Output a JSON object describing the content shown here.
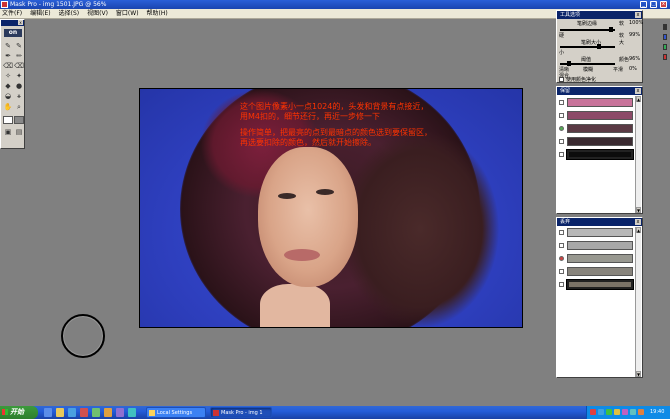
{
  "window": {
    "title": "Mask Pro - img 1501.JPG @ 56%",
    "minimize_label": "_",
    "maximize_label": "□",
    "close_label": "x"
  },
  "menu": {
    "items": [
      "文件(F)",
      "编辑(E)",
      "选择(S)",
      "视图(V)",
      "窗口(W)",
      "帮助(H)"
    ]
  },
  "toolbox": {
    "logo": "on",
    "close_label": "x"
  },
  "canvas": {
    "annotation_lines": [
      "这个图片像素小一点1024的，头发和背景有点接近，",
      "用M4扣的，细节还行，再近一步修一下",
      "操作简单，把最亮的点到最暗点的颜色选到要保留区，",
      "再选要扣除的颜色，然后就开始擦除。"
    ]
  },
  "tool_options": {
    "title": "工具选项",
    "close_label": "x",
    "row1_label": "笔刷边缘",
    "row1_right": "软",
    "row1_value": "100%",
    "row2_left": "硬",
    "row2_right": "软",
    "row2_value": "99%",
    "row3_label": "笔刷大小",
    "row3_right": "大",
    "row4_label": "阈值",
    "row4_left": "小",
    "row5_label": "颜色",
    "row5_value": "96%",
    "row6_left": "清晰",
    "row6_mid": "模糊",
    "row6_right": "平滑",
    "row6_value": "0%",
    "row7_left": "混合",
    "checkbox_label": "使用颜色净化"
  },
  "keep_colors": {
    "title": "保留",
    "close_label": "x",
    "swatches": [
      "#c8739a",
      "#8c4a68",
      "#5a3a44",
      "#3a2a30",
      "#0c0c0c"
    ],
    "selected_index": 4
  },
  "drop_colors": {
    "title": "丢弃",
    "close_label": "x",
    "swatches": [
      "#b8b8b8",
      "#a8a8a8",
      "#989890",
      "#88847c",
      "#7c7468"
    ],
    "selected_index": 4
  },
  "taskbar": {
    "start_label": "开始",
    "items": [
      {
        "label": "Local Settings",
        "active": false
      },
      {
        "label": "Mask Pro - img 1",
        "active": true
      }
    ],
    "clock": "19:40"
  },
  "colors": {
    "canvas_bg": "#3447c8",
    "annotation": "#ff3300",
    "title_bar": "#1a44b0"
  }
}
